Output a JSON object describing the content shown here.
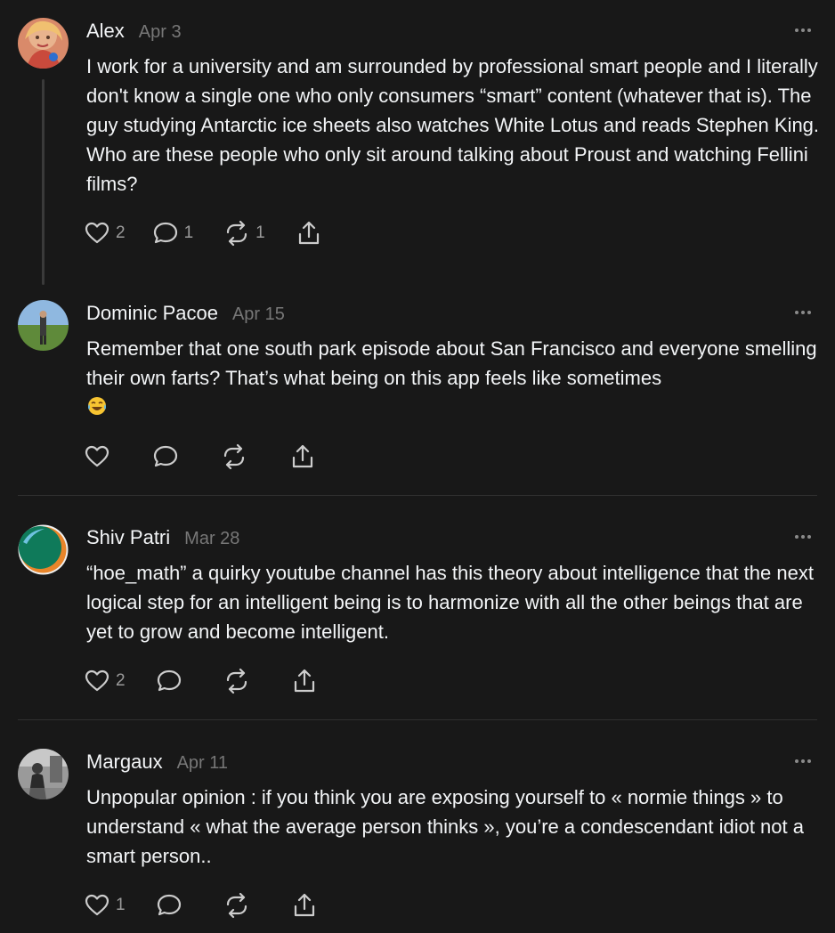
{
  "posts": [
    {
      "username": "Alex",
      "date": "Apr 3",
      "avatar": "avatar-alex-photo",
      "text": "I work for a university and am surrounded by professional smart people and I literally don't know a single one who only consumers “smart” content (whatever that is). The guy studying Antarctic ice sheets also watches White Lotus and reads Stephen King. Who are these people who only sit around talking about Proust and watching Fellini films?",
      "likes": "2",
      "replies": "1",
      "reposts": "1"
    },
    {
      "username": "Dominic Pacoe",
      "date": "Apr 15",
      "avatar": "avatar-dominic-photo",
      "text": "Remember that one south park episode about San Francisco and everyone smelling their own farts? That’s what being on this app feels like sometimes",
      "emoji": "face-with-tears-of-joy",
      "likes": "",
      "replies": "",
      "reposts": ""
    },
    {
      "username": "Shiv Patri",
      "date": "Mar 28",
      "avatar": "avatar-shiv-logo",
      "text": "“hoe_math” a quirky youtube channel has this theory about intelligence that the next logical step for an intelligent being is to harmonize with all the other beings that are yet to grow and become intelligent.",
      "likes": "2",
      "replies": "",
      "reposts": ""
    },
    {
      "username": "Margaux",
      "date": "Apr 11",
      "avatar": "avatar-margaux-photo",
      "text": "Unpopular opinion : if you think you are exposing yourself to « normie things » to understand « what the average person thinks », you’re a condescendant idiot not a smart person..",
      "likes": "1",
      "replies": "",
      "reposts": ""
    }
  ],
  "icons": {
    "like": "heart-icon",
    "reply": "comment-icon",
    "repost": "repost-icon",
    "share": "share-icon",
    "more": "more-options-icon"
  },
  "colors": {
    "background": "#181818",
    "text": "#f3f5f7",
    "muted": "#777777",
    "icon": "#cccccc",
    "divider": "#303030"
  }
}
